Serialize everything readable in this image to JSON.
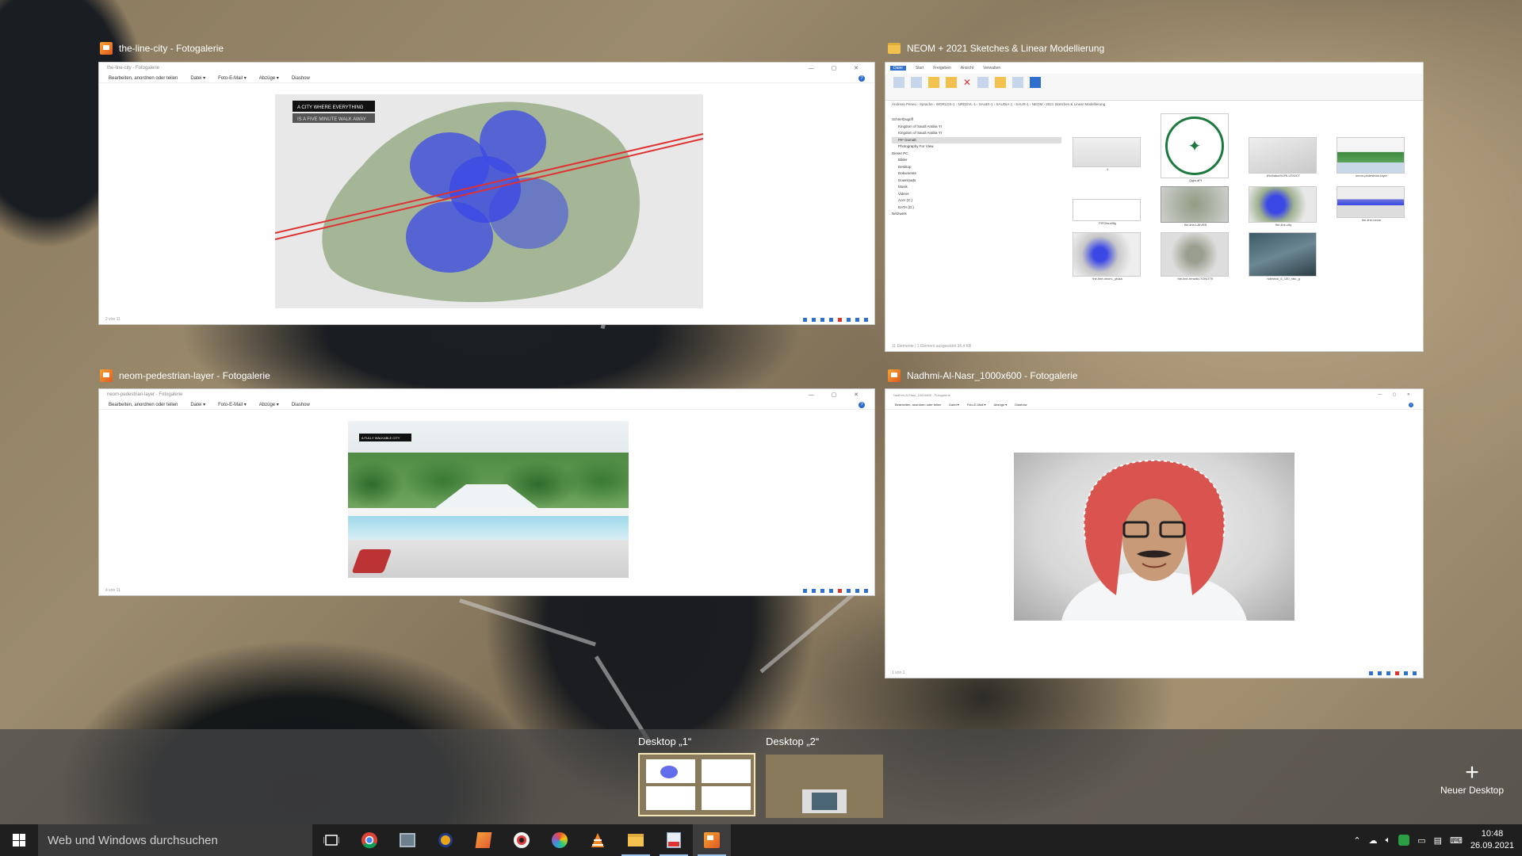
{
  "windows": [
    {
      "title": "the-line-city - Fotogalerie",
      "caption": "the-line-city - Fotogalerie",
      "menu": [
        "Bearbeiten, anordnen oder teilen",
        "Datei ▾",
        "Foto-E-Mail ▾",
        "Abzüge ▾",
        "Diashow"
      ],
      "status": "2 von 11",
      "overlay_line1": "A CITY WHERE EVERYTHING",
      "overlay_line2": "IS A FIVE MINUTE WALK AWAY"
    },
    {
      "title": "NEOM + 2021 Sketches & Linear Modellierung",
      "caption": "NEOM + 2021 Sketches & Linear Modellierung",
      "ribbon_tabs": [
        "Datei",
        "Start",
        "Freigeben",
        "Ansicht",
        "Verwalten"
      ],
      "address": "Andreas Peneu › Sprache › WORLDS-1 › NRDSVL-1 › SAUDI-1 › SAUDIA-1 › SAUR-1 › NEOM › 2021 Sketches & Linear Modellierung",
      "tree": [
        "Schnellzugriff",
        "Kingdom of Saudi Arabia YI",
        "Kingdom of Saudi Arabia YI",
        "PIF Dumatt",
        "Photography For View",
        "Dieser PC",
        "Bilder",
        "Desktop",
        "Dokumente",
        "Downloads",
        "Musik",
        "Videos",
        "Acer (C:)",
        "DATA (D:)",
        "Netzwerk"
      ],
      "files": [
        "4",
        "Qqjw.dPf",
        "69d0dba9VJRLVZ92CT",
        "neom-pedestrian-layer",
        "PIFDfsudlfig",
        "the-line-LAIVEB",
        "the-line-city",
        "the-line-neom",
        "the-line-neom-_ytuka",
        "the-line-renwild-TONGTE",
        "ndimnck_6_100_nbu_g"
      ],
      "status": "11 Elemente | 1 Element ausgewählt 34,4 KB"
    },
    {
      "title": "neom-pedestrian-layer - Fotogalerie",
      "caption": "neom-pedestrian-layer - Fotogalerie",
      "menu": [
        "Bearbeiten, anordnen oder teilen",
        "Datei ▾",
        "Foto-E-Mail ▾",
        "Abzüge ▾",
        "Diashow"
      ],
      "status": "4 von 11",
      "overlay_line1": "A FULLY WALKABLE CITY"
    },
    {
      "title": "Nadhmi-Al-Nasr_1000x600 - Fotogalerie",
      "caption": "Nadhmi-Al-Nasr_1000x600 - Fotogalerie",
      "menu": [
        "Bearbeiten, anordnen oder teilen",
        "Datei ▾",
        "Foto-E-Mail ▾",
        "Abzüge ▾",
        "Diashow"
      ],
      "status": "1 von 1"
    }
  ],
  "desktops": {
    "d1": "Desktop „1“",
    "d2": "Desktop „2“",
    "new": "Neuer Desktop"
  },
  "taskbar": {
    "search_placeholder": "Web und Windows durchsuchen",
    "icons": [
      "task-view",
      "chrome",
      "photo-viewer",
      "bug-app",
      "pictures-app",
      "opera",
      "media-app",
      "vlc",
      "file-explorer",
      "fotogalerie-pdf",
      "fotogalerie"
    ],
    "time": "10:48",
    "date": "26.09.2021"
  },
  "colors": {
    "accent": "#2f6fce",
    "taskbar": "#1f1f1f",
    "search": "#3a3a3a",
    "fotogalerie_icon": "#f6a331",
    "folder": "#f2c14e"
  }
}
